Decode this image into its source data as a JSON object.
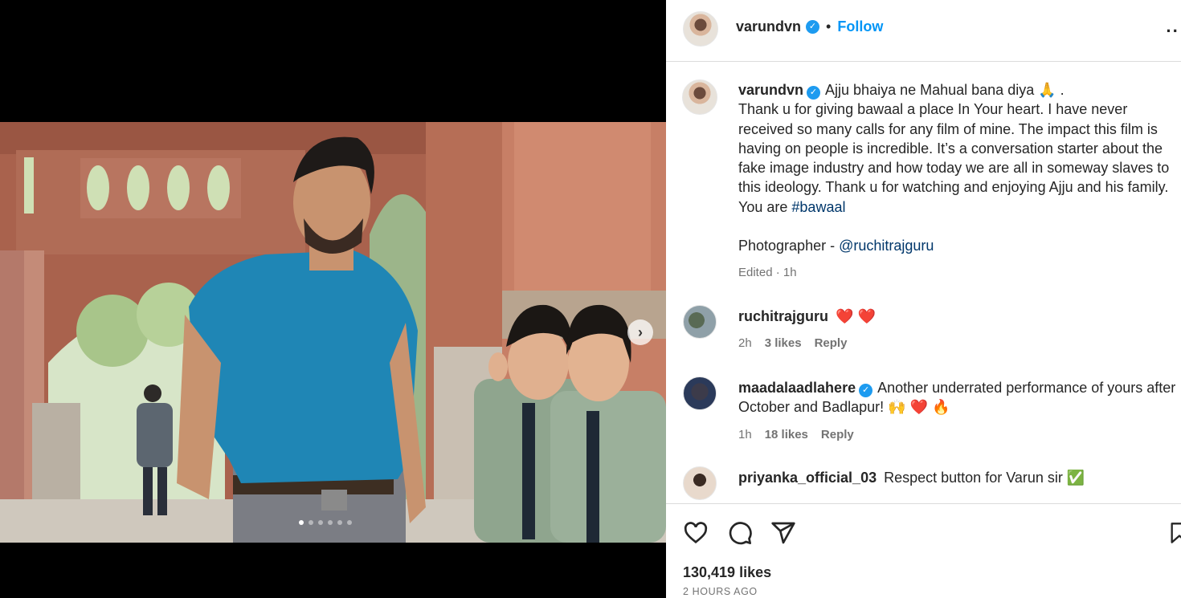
{
  "post": {
    "username": "varundvn",
    "follow_label": "Follow",
    "separator": "•",
    "more_label": "⋯"
  },
  "media": {
    "next_icon": "chevron-right-icon",
    "slide_count": 6,
    "active_slide": 1
  },
  "caption": {
    "username": "varundvn",
    "line1": "Ajju bhaiya ne Mahual bana diya 🙏 .",
    "body": "Thank u for giving bawaal a place In Your heart. I have never received so many calls for any film of mine. The impact this film is having on people is incredible. It’s a conversation starter about the fake image industry and how today we are all in someway slaves to this ideology. Thank u for watching and enjoying Ajju and his family. You are ",
    "hashtag": "#bawaal",
    "photographer_prefix": "Photographer - ",
    "photographer_handle": "@ruchitrajguru",
    "meta": "Edited · 1h"
  },
  "comments": [
    {
      "username": "ruchitrajguru",
      "verified": false,
      "text": "❤️ ❤️",
      "age": "2h",
      "likes": "3 likes",
      "reply": "Reply"
    },
    {
      "username": "maadalaadlahere",
      "verified": true,
      "text": "Another underrated performance of yours after October and Badlapur! 🙌 ❤️ 🔥",
      "age": "1h",
      "likes": "18 likes",
      "reply": "Reply"
    },
    {
      "username": "priyanka_official_03",
      "verified": false,
      "text": "Respect button for Varun sir ✅"
    }
  ],
  "footer": {
    "likes": "130,419 likes",
    "time": "2 HOURS AGO"
  },
  "colors": {
    "accent": "#0095f6",
    "link": "#00376b",
    "verified": "#1d9bf0"
  }
}
